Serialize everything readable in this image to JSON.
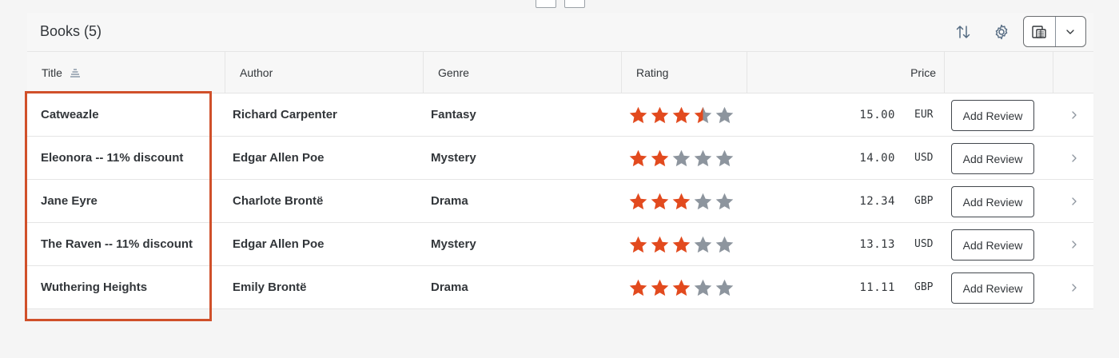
{
  "table": {
    "title": "Books (5)",
    "toolbar": {
      "sort_icon": "sort-icon",
      "settings_icon": "gear-icon",
      "export_icon": "export-icon",
      "dropdown_icon": "chevron-down-icon"
    },
    "columns": {
      "title": "Title",
      "author": "Author",
      "genre": "Genre",
      "rating": "Rating",
      "price": "Price"
    },
    "rows": [
      {
        "title": "Catweazle",
        "author": "Richard Carpenter",
        "genre": "Fantasy",
        "rating": 3.5,
        "price": "15.00",
        "currency": "EUR",
        "action": "Add Review"
      },
      {
        "title": "Eleonora -- 11% discount",
        "author": "Edgar Allen Poe",
        "genre": "Mystery",
        "rating": 2,
        "price": "14.00",
        "currency": "USD",
        "action": "Add Review"
      },
      {
        "title": "Jane Eyre",
        "author": "Charlote Brontë",
        "genre": "Drama",
        "rating": 3,
        "price": "12.34",
        "currency": "GBP",
        "action": "Add Review"
      },
      {
        "title": "The Raven -- 11% discount",
        "author": "Edgar Allen Poe",
        "genre": "Mystery",
        "rating": 3,
        "price": "13.13",
        "currency": "USD",
        "action": "Add Review"
      },
      {
        "title": "Wuthering Heights",
        "author": "Emily Brontë",
        "genre": "Drama",
        "rating": 3,
        "price": "11.11",
        "currency": "GBP",
        "action": "Add Review"
      }
    ]
  },
  "colors": {
    "star_filled": "#e24a1e",
    "star_empty": "#8d959e",
    "highlight": "#d0502a"
  }
}
